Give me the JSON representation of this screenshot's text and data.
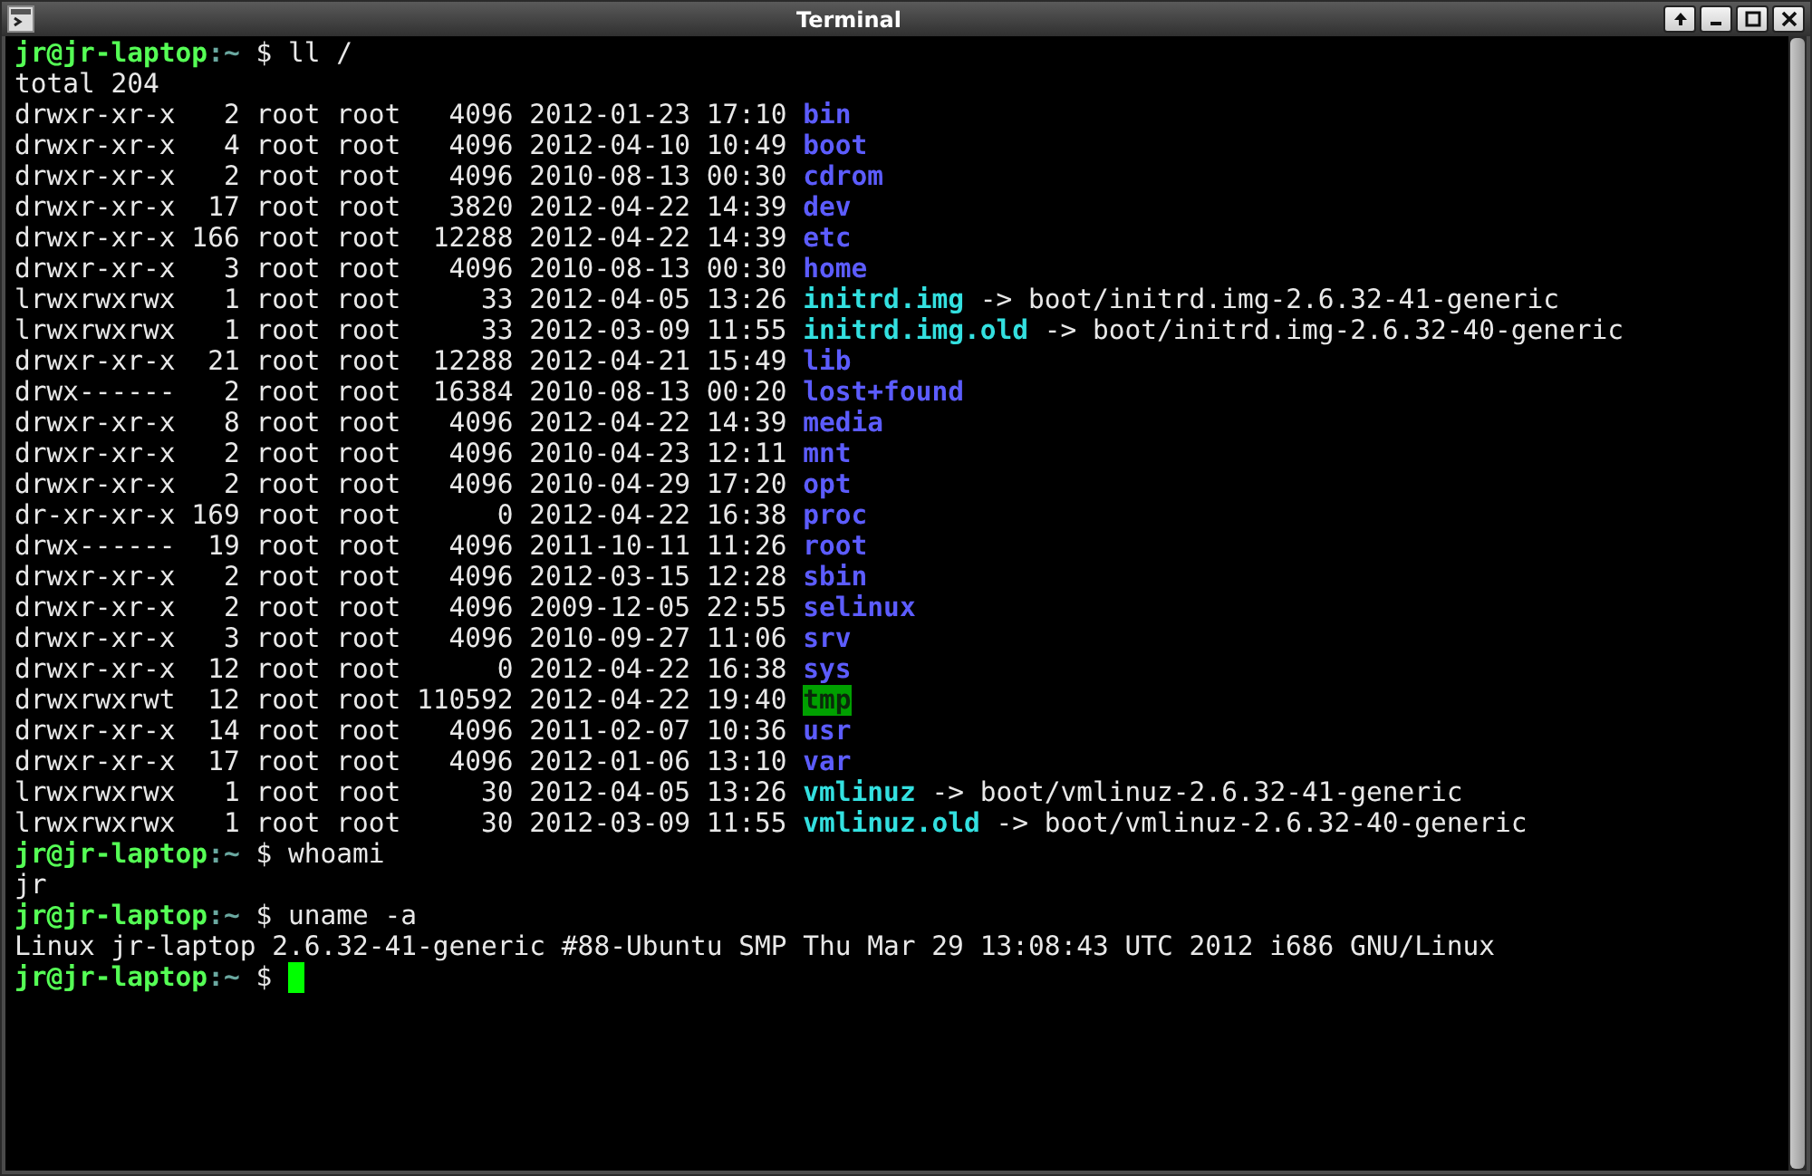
{
  "window": {
    "title": "Terminal"
  },
  "lines": [
    {
      "kind": "prompt",
      "user_host": "jr@jr-laptop",
      "path": ":~",
      "command": "$ ll /"
    },
    {
      "kind": "output",
      "text": "total 204"
    },
    {
      "kind": "listing",
      "meta": "drwxr-xr-x   2 root root   4096 2012-01-23 17:10",
      "name": "bin",
      "color": "#5c5cff",
      "highlighted": false
    },
    {
      "kind": "listing",
      "meta": "drwxr-xr-x   4 root root   4096 2012-04-10 10:49",
      "name": "boot",
      "color": "#5c5cff",
      "highlighted": false
    },
    {
      "kind": "listing",
      "meta": "drwxr-xr-x   2 root root   4096 2010-08-13 00:30",
      "name": "cdrom",
      "color": "#5c5cff",
      "highlighted": false
    },
    {
      "kind": "listing",
      "meta": "drwxr-xr-x  17 root root   3820 2012-04-22 14:39",
      "name": "dev",
      "color": "#5c5cff",
      "highlighted": false
    },
    {
      "kind": "listing",
      "meta": "drwxr-xr-x 166 root root  12288 2012-04-22 14:39",
      "name": "etc",
      "color": "#5c5cff",
      "highlighted": false
    },
    {
      "kind": "listing",
      "meta": "drwxr-xr-x   3 root root   4096 2010-08-13 00:30",
      "name": "home",
      "color": "#5c5cff",
      "highlighted": false
    },
    {
      "kind": "listing",
      "meta": "lrwxrwxrwx   1 root root     33 2012-04-05 13:26",
      "name": "initrd.img",
      "color": "#33e0e0",
      "highlighted": false,
      "target": "-> boot/initrd.img-2.6.32-41-generic"
    },
    {
      "kind": "listing",
      "meta": "lrwxrwxrwx   1 root root     33 2012-03-09 11:55",
      "name": "initrd.img.old",
      "color": "#33e0e0",
      "highlighted": false,
      "target": "-> boot/initrd.img-2.6.32-40-generic"
    },
    {
      "kind": "listing",
      "meta": "drwxr-xr-x  21 root root  12288 2012-04-21 15:49",
      "name": "lib",
      "color": "#5c5cff",
      "highlighted": false
    },
    {
      "kind": "listing",
      "meta": "drwx------   2 root root  16384 2010-08-13 00:20",
      "name": "lost+found",
      "color": "#5c5cff",
      "highlighted": false
    },
    {
      "kind": "listing",
      "meta": "drwxr-xr-x   8 root root   4096 2012-04-22 14:39",
      "name": "media",
      "color": "#5c5cff",
      "highlighted": false
    },
    {
      "kind": "listing",
      "meta": "drwxr-xr-x   2 root root   4096 2010-04-23 12:11",
      "name": "mnt",
      "color": "#5c5cff",
      "highlighted": false
    },
    {
      "kind": "listing",
      "meta": "drwxr-xr-x   2 root root   4096 2010-04-29 17:20",
      "name": "opt",
      "color": "#5c5cff",
      "highlighted": false
    },
    {
      "kind": "listing",
      "meta": "dr-xr-xr-x 169 root root      0 2012-04-22 16:38",
      "name": "proc",
      "color": "#5c5cff",
      "highlighted": false
    },
    {
      "kind": "listing",
      "meta": "drwx------  19 root root   4096 2011-10-11 11:26",
      "name": "root",
      "color": "#5c5cff",
      "highlighted": false
    },
    {
      "kind": "listing",
      "meta": "drwxr-xr-x   2 root root   4096 2012-03-15 12:28",
      "name": "sbin",
      "color": "#5c5cff",
      "highlighted": false
    },
    {
      "kind": "listing",
      "meta": "drwxr-xr-x   2 root root   4096 2009-12-05 22:55",
      "name": "selinux",
      "color": "#5c5cff",
      "highlighted": false
    },
    {
      "kind": "listing",
      "meta": "drwxr-xr-x   3 root root   4096 2010-09-27 11:06",
      "name": "srv",
      "color": "#5c5cff",
      "highlighted": false
    },
    {
      "kind": "listing",
      "meta": "drwxr-xr-x  12 root root      0 2012-04-22 16:38",
      "name": "sys",
      "color": "#5c5cff",
      "highlighted": false
    },
    {
      "kind": "listing",
      "meta": "drwxrwxrwt  12 root root 110592 2012-04-22 19:40",
      "name": "tmp",
      "color": "#00a000",
      "highlighted": true
    },
    {
      "kind": "listing",
      "meta": "drwxr-xr-x  14 root root   4096 2011-02-07 10:36",
      "name": "usr",
      "color": "#5c5cff",
      "highlighted": false
    },
    {
      "kind": "listing",
      "meta": "drwxr-xr-x  17 root root   4096 2012-01-06 13:10",
      "name": "var",
      "color": "#5c5cff",
      "highlighted": false
    },
    {
      "kind": "listing",
      "meta": "lrwxrwxrwx   1 root root     30 2012-04-05 13:26",
      "name": "vmlinuz",
      "color": "#33e0e0",
      "highlighted": false,
      "target": "-> boot/vmlinuz-2.6.32-41-generic"
    },
    {
      "kind": "listing",
      "meta": "lrwxrwxrwx   1 root root     30 2012-03-09 11:55",
      "name": "vmlinuz.old",
      "color": "#33e0e0",
      "highlighted": false,
      "target": "-> boot/vmlinuz-2.6.32-40-generic"
    },
    {
      "kind": "prompt",
      "user_host": "jr@jr-laptop",
      "path": ":~",
      "command": "$ whoami"
    },
    {
      "kind": "output",
      "text": "jr"
    },
    {
      "kind": "prompt",
      "user_host": "jr@jr-laptop",
      "path": ":~",
      "command": "$ uname -a"
    },
    {
      "kind": "output",
      "text": "Linux jr-laptop 2.6.32-41-generic #88-Ubuntu SMP Thu Mar 29 13:08:43 UTC 2012 i686 GNU/Linux"
    },
    {
      "kind": "prompt",
      "user_host": "jr@jr-laptop",
      "path": ":~",
      "command": "$",
      "cursor": true
    }
  ]
}
